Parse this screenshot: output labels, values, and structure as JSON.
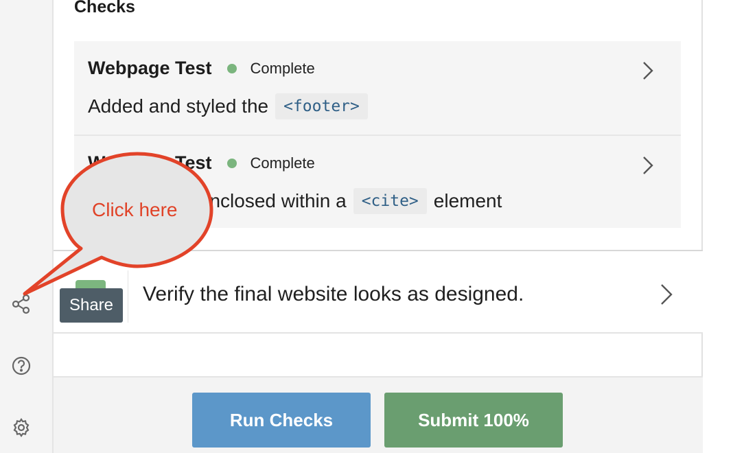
{
  "checks": {
    "title": "Checks",
    "items": [
      {
        "name": "Webpage Test",
        "status": "Complete",
        "desc_before": "Added and styled the",
        "code": "<footer>",
        "desc_after": ""
      },
      {
        "name": "Webpage Test",
        "status": "Complete",
        "desc_before": "The quote is enclosed within a",
        "code": "<cite>",
        "desc_after": "element"
      }
    ]
  },
  "verify": {
    "text": "Verify the final website looks as designed."
  },
  "footer": {
    "run_label": "Run Checks",
    "submit_label": "Submit 100%"
  },
  "tooltip": {
    "label": "Share"
  },
  "callout": {
    "text": "Click here"
  },
  "colors": {
    "complete": "#7bb57e",
    "run": "#5c97c9",
    "submit": "#6a9e70",
    "callout": "#e04328"
  },
  "icons": [
    "share-icon",
    "help-icon",
    "settings-icon",
    "chevron-right-icon"
  ]
}
